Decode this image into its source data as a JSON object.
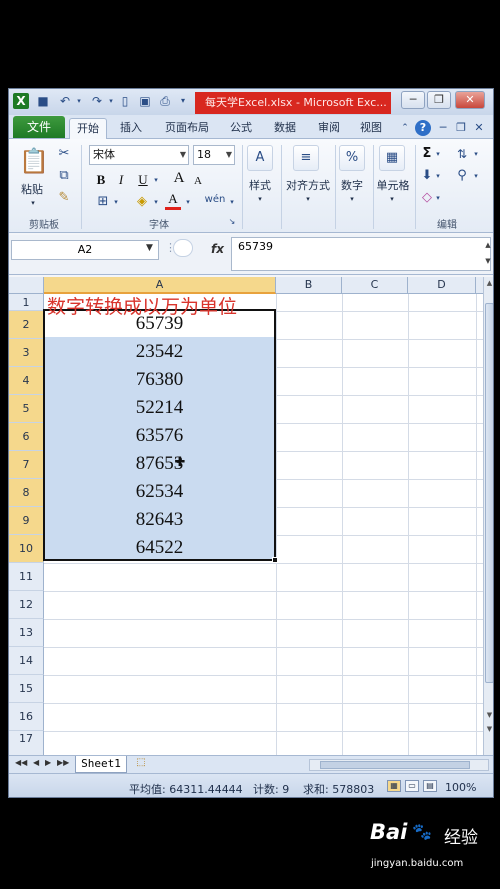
{
  "window": {
    "title": "每天学Excel.xlsx - Microsoft Exc...",
    "controls": {
      "minimize": "─",
      "restore": "❐",
      "close": "✕"
    }
  },
  "ribbon": {
    "file_tab": "文件",
    "tabs": [
      "开始",
      "插入",
      "页面布局",
      "公式",
      "数据",
      "审阅",
      "视图"
    ],
    "active_tab": "开始",
    "clipboard": {
      "paste": "粘贴",
      "group": "剪贴板"
    },
    "font": {
      "name": "宋体",
      "size": "18",
      "bold": "B",
      "italic": "I",
      "underline": "U",
      "grow": "A",
      "shrink": "A",
      "font_color_letter": "A",
      "phonetic": "wén",
      "group": "字体"
    },
    "styles": {
      "label": "样式"
    },
    "alignment": {
      "label": "对齐方式"
    },
    "number": {
      "label": "数字",
      "icon_text": "%"
    },
    "cells": {
      "label": "单元格"
    },
    "editing": {
      "group": "编辑",
      "sum": "Σ"
    }
  },
  "formula_bar": {
    "name_box": "A2",
    "fx": "fx",
    "value": "65739"
  },
  "grid": {
    "columns": [
      "A",
      "B",
      "C",
      "D"
    ],
    "rows": [
      "1",
      "2",
      "3",
      "4",
      "5",
      "6",
      "7",
      "8",
      "9",
      "10",
      "11",
      "12",
      "13",
      "14",
      "15",
      "16",
      "17"
    ],
    "title_cell": "数字转换成以万为单位",
    "values": [
      "65739",
      "23542",
      "76380",
      "52214",
      "63576",
      "87653",
      "62534",
      "82643",
      "64522"
    ]
  },
  "sheets": {
    "tabs": [
      "Sheet1"
    ]
  },
  "status_bar": {
    "average": "平均值: 64311.44444",
    "count": "计数: 9",
    "sum": "求和: 578803",
    "zoom": "100%"
  },
  "watermark": {
    "logo": "Bai",
    "logo_suffix": "百度",
    "jingyan": "经验",
    "url": "jingyan.baidu.com"
  },
  "colors": {
    "title_text": "#d9342c",
    "selection": "#cadbf0",
    "file_tab": "#1e7a25",
    "window_title_bar": "#d8271f"
  }
}
